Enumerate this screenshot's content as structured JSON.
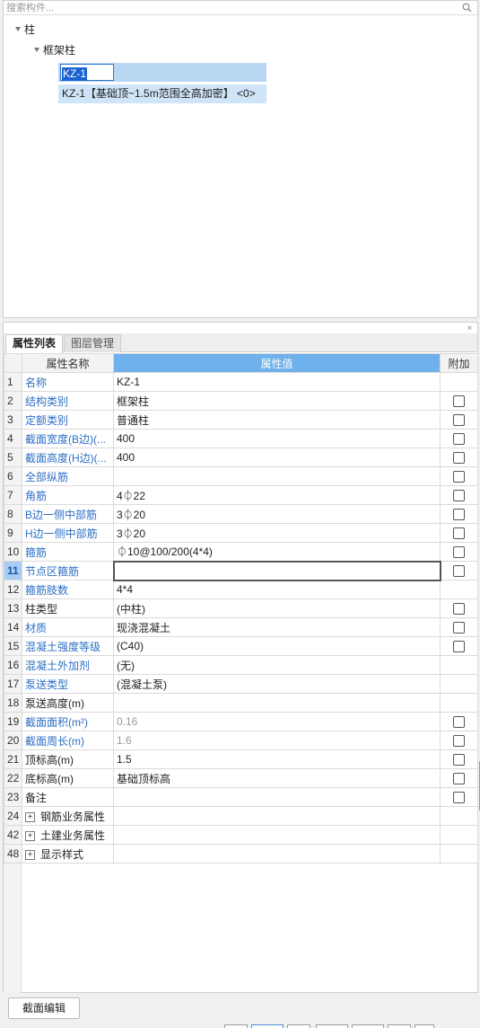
{
  "search": {
    "placeholder": "搜索构件..."
  },
  "tree": {
    "root": "柱",
    "child": "框架柱",
    "items": [
      {
        "label": "KZ-1",
        "editing": true
      },
      {
        "label": "KZ-1【基础顶~1.5m范围全高加密】 <0>"
      }
    ]
  },
  "props": {
    "tabs": [
      "属性列表",
      "图层管理"
    ],
    "headers": {
      "name": "属性名称",
      "value": "属性值",
      "add": "附加"
    },
    "rows": [
      {
        "no": "1",
        "name": "名称",
        "value": "KZ-1",
        "blue": true,
        "checkbox": false
      },
      {
        "no": "2",
        "name": "结构类别",
        "value": "框架柱",
        "blue": true,
        "checkbox": true
      },
      {
        "no": "3",
        "name": "定额类别",
        "value": "普通柱",
        "blue": true,
        "checkbox": true
      },
      {
        "no": "4",
        "name": "截面宽度(B边)(...",
        "value": "400",
        "blue": true,
        "checkbox": true
      },
      {
        "no": "5",
        "name": "截面高度(H边)(...",
        "value": "400",
        "blue": true,
        "checkbox": true
      },
      {
        "no": "6",
        "name": "全部纵筋",
        "value": "",
        "blue": true,
        "checkbox": true
      },
      {
        "no": "7",
        "name": "角筋",
        "value": "4⏀22",
        "blue": true,
        "checkbox": true
      },
      {
        "no": "8",
        "name": "B边一侧中部筋",
        "value": "3⏀20",
        "blue": true,
        "checkbox": true
      },
      {
        "no": "9",
        "name": "H边一侧中部筋",
        "value": "3⏀20",
        "blue": true,
        "checkbox": true
      },
      {
        "no": "10",
        "name": "箍筋",
        "value": "⏀10@100/200(4*4)",
        "blue": true,
        "checkbox": true
      },
      {
        "no": "11",
        "name": "节点区箍筋",
        "value": "",
        "blue": true,
        "checkbox": true,
        "active": true
      },
      {
        "no": "12",
        "name": "箍筋肢数",
        "value": "4*4",
        "blue": true,
        "checkbox": false
      },
      {
        "no": "13",
        "name": "柱类型",
        "value": "(中柱)",
        "blue": false,
        "checkbox": true
      },
      {
        "no": "14",
        "name": "材质",
        "value": "现浇混凝土",
        "blue": true,
        "checkbox": true
      },
      {
        "no": "15",
        "name": "混凝土强度等级",
        "value": "(C40)",
        "blue": true,
        "checkbox": true
      },
      {
        "no": "16",
        "name": "混凝土外加剂",
        "value": "(无)",
        "blue": true,
        "checkbox": false
      },
      {
        "no": "17",
        "name": "泵送类型",
        "value": "(混凝土泵)",
        "blue": true,
        "checkbox": false
      },
      {
        "no": "18",
        "name": "泵送高度(m)",
        "value": "",
        "blue": false,
        "checkbox": false
      },
      {
        "no": "19",
        "name": "截面面积(m²)",
        "value": "0.16",
        "blue": true,
        "checkbox": true,
        "grey": true
      },
      {
        "no": "20",
        "name": "截面周长(m)",
        "value": "1.6",
        "blue": true,
        "checkbox": true,
        "grey": true
      },
      {
        "no": "21",
        "name": "顶标高(m)",
        "value": "1.5",
        "blue": false,
        "checkbox": true
      },
      {
        "no": "22",
        "name": "底标高(m)",
        "value": "基础顶标高",
        "blue": false,
        "checkbox": true
      },
      {
        "no": "23",
        "name": "备注",
        "value": "",
        "blue": false,
        "checkbox": true
      },
      {
        "no": "24",
        "name": "钢筋业务属性",
        "value": "",
        "blue": false,
        "checkbox": false,
        "group": true
      },
      {
        "no": "42",
        "name": "土建业务属性",
        "value": "",
        "blue": false,
        "checkbox": false,
        "group": true
      },
      {
        "no": "48",
        "name": "显示样式",
        "value": "",
        "blue": false,
        "checkbox": false,
        "group": true
      }
    ]
  },
  "footer": {
    "section_edit": "截面编辑"
  }
}
